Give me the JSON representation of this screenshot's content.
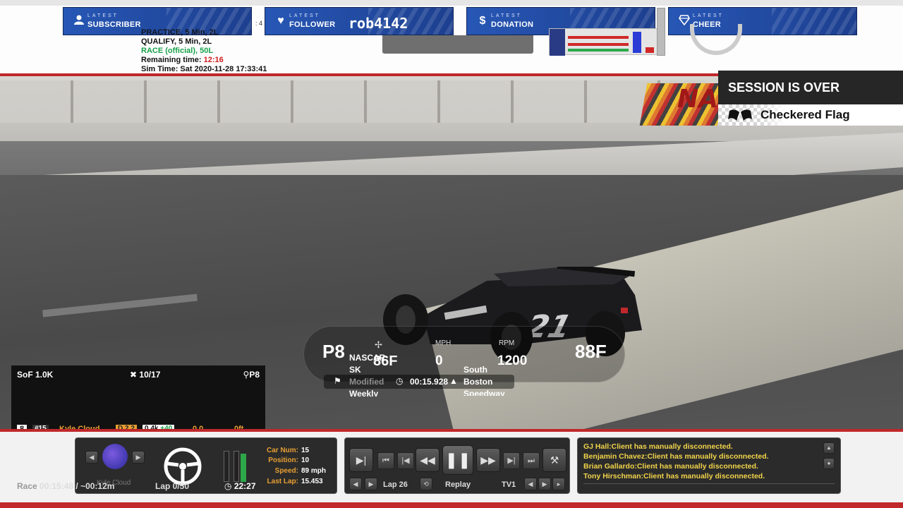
{
  "alerts": [
    {
      "small": "LATEST",
      "title": "SUBSCRIBER",
      "icon": "user-icon",
      "value": ""
    },
    {
      "small": "LATEST",
      "title": "FOLLOWER",
      "icon": "heart-icon",
      "value": "rob4142"
    },
    {
      "small": "LATEST",
      "title": "DONATION",
      "icon": "dollar-icon",
      "value": ""
    },
    {
      "small": "LATEST",
      "title": "CHEER",
      "icon": "diamond-icon",
      "value": ""
    }
  ],
  "session_info": {
    "line1": "PRACTICE, 5 Min, 2L",
    "line2": "QUALIFY, 5 Min, 2L",
    "line3": "RACE (official), 50L",
    "remaining_label": "Remaining time:",
    "remaining_value": "12:16",
    "sim_time": "Sim Time: Sat 2020-11-28 17:33:41",
    "side_num": ": 4"
  },
  "session_over": {
    "title": "SESSION IS OVER",
    "flag": "Checkered Flag"
  },
  "hud": {
    "position": "P8",
    "series": [
      "NASCAR",
      "SK",
      "Modified",
      "Weekly"
    ],
    "temp_track": "86F",
    "mph_label": "MPH",
    "mph_value": "0",
    "rpm_label": "RPM",
    "rpm_value": "1200",
    "temp_air": "88F",
    "track": [
      "South",
      "Boston",
      "Speedway"
    ],
    "lap_time": "00:15.928"
  },
  "standings": {
    "sof": "SoF 1.0K",
    "count": "10/17",
    "pos": "P8",
    "row": {
      "pos": "8",
      "num": "#15",
      "name": "Kyle Cloud",
      "lic": "D 2.2",
      "ir": "0.4k",
      "ir_delta": "+40",
      "gap": "0.0",
      "dist": "0ft"
    }
  },
  "driver_panel": {
    "labels": [
      "Car Num:",
      "Position:",
      "Speed:",
      "Last Lap:"
    ],
    "values": [
      "15",
      "10",
      "89 mph",
      "15.453"
    ],
    "lap": "Lap 0/50",
    "clock": "22:27",
    "name_faded": "Kyle Cloud"
  },
  "race_time": {
    "prefix": "Race",
    "value": "00:15:48 / ~00:12m"
  },
  "camera_panel": {
    "lap": "Lap 26",
    "mode": "Replay",
    "camera": "TV1"
  },
  "chat": [
    "GJ Hall:Client has manually disconnected.",
    "Benjamin Chavez:Client has manually disconnected.",
    "Brian Gallardo:Client has manually disconnected.",
    "Tony Hirschman:Client has manually disconnected."
  ],
  "sponsor": "NAS",
  "colors": {
    "accent_red": "#c0282b",
    "alert_blue": "#2757b5",
    "chat_yellow": "#f2d44a",
    "label_orange": "#e8a033"
  }
}
